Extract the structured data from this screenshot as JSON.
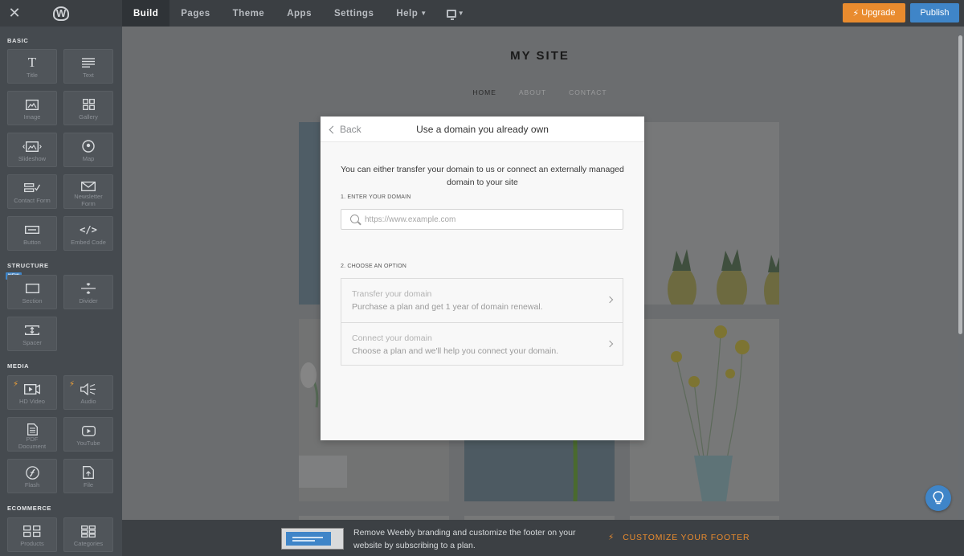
{
  "topbar": {
    "close_glyph": "✕",
    "logo_glyph": "W",
    "tabs": [
      {
        "label": "Build",
        "active": true
      },
      {
        "label": "Pages",
        "active": false
      },
      {
        "label": "Theme",
        "active": false
      },
      {
        "label": "Apps",
        "active": false
      },
      {
        "label": "Settings",
        "active": false
      },
      {
        "label": "Help",
        "active": false
      }
    ],
    "upgrade_label": "Upgrade",
    "publish_label": "Publish",
    "colors": {
      "upgrade": "#e98b2e",
      "publish": "#3f85c8"
    }
  },
  "sidebar": {
    "sections": {
      "basic": "BASIC",
      "structure": "STRUCTURE",
      "media": "MEDIA",
      "ecommerce": "ECOMMERCE"
    },
    "new_badge": "NEW",
    "elements": {
      "title": {
        "label": "Title",
        "icon": "title-icon"
      },
      "text": {
        "label": "Text",
        "icon": "text-lines-icon"
      },
      "image": {
        "label": "Image",
        "icon": "image-icon"
      },
      "gallery": {
        "label": "Gallery",
        "icon": "gallery-grid-icon"
      },
      "slideshow": {
        "label": "Slideshow",
        "icon": "slideshow-icon"
      },
      "map": {
        "label": "Map",
        "icon": "map-pin-icon"
      },
      "contact_form": {
        "label": "Contact Form",
        "icon": "form-check-icon"
      },
      "newsletter_form": {
        "label": "Newsletter Form",
        "icon": "envelope-icon"
      },
      "button": {
        "label": "Button",
        "icon": "button-icon"
      },
      "embed_code": {
        "label": "Embed Code",
        "icon": "code-icon"
      },
      "section": {
        "label": "Section",
        "icon": "section-icon"
      },
      "divider": {
        "label": "Divider",
        "icon": "divider-icon"
      },
      "spacer": {
        "label": "Spacer",
        "icon": "spacer-icon"
      },
      "hd_video": {
        "label": "HD Video",
        "icon": "video-icon"
      },
      "audio": {
        "label": "Audio",
        "icon": "audio-speaker-icon"
      },
      "pdf_document": {
        "label": "PDF Document",
        "icon": "document-icon"
      },
      "youtube": {
        "label": "YouTube",
        "icon": "youtube-play-icon"
      },
      "flash": {
        "label": "Flash",
        "icon": "flash-icon"
      },
      "file": {
        "label": "File",
        "icon": "file-icon"
      },
      "products": {
        "label": "Products",
        "icon": "products-icon"
      },
      "categories": {
        "label": "Categories",
        "icon": "categories-icon"
      }
    }
  },
  "site": {
    "title": "MY SITE",
    "nav": [
      "HOME",
      "ABOUT",
      "CONTACT"
    ]
  },
  "modal": {
    "back_label": "Back",
    "title": "Use a domain you already own",
    "intro": "You can either transfer your domain to us or connect an externally managed domain to your site",
    "step1_label": "1. ENTER YOUR DOMAIN",
    "domain_placeholder": "https://www.example.com",
    "step2_label": "2. CHOOSE AN OPTION",
    "options": [
      {
        "title": "Transfer your domain",
        "desc": "Purchase a plan and get 1 year of domain renewal."
      },
      {
        "title": "Connect your domain",
        "desc": "Choose a plan and we'll help you connect your domain."
      }
    ]
  },
  "footer": {
    "message": "Remove Weebly branding and customize the footer on your website by subscribing to a plan.",
    "cta_label": "CUSTOMIZE YOUR FOOTER",
    "cta_color": "#e98b2e"
  }
}
